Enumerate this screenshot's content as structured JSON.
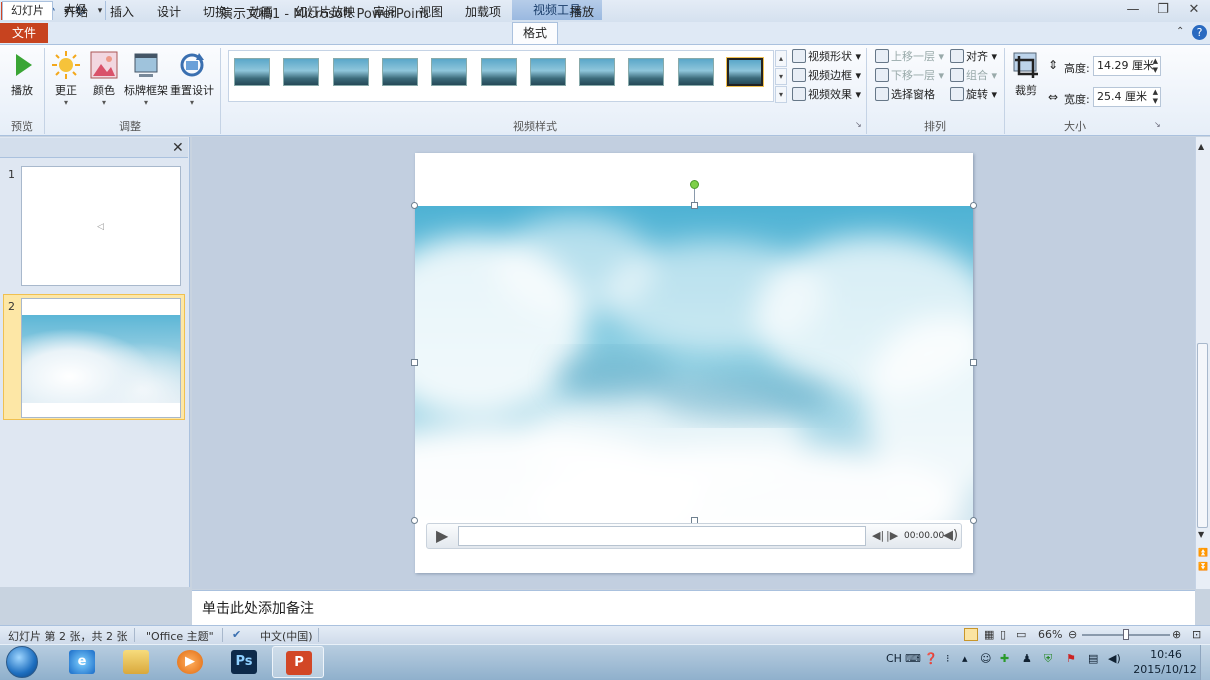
{
  "window": {
    "title": "演示文稿1 - Microsoft PowerPoint",
    "app_icon": "P",
    "context_tools_header": "视频工具"
  },
  "tabs": {
    "file": "文件",
    "items": [
      "开始",
      "插入",
      "设计",
      "切换",
      "动画",
      "幻灯片放映",
      "审阅",
      "视图",
      "加载项",
      "格式",
      "播放"
    ],
    "active": "格式"
  },
  "ribbon": {
    "preview": {
      "play_label": "播放",
      "group_label": "预览"
    },
    "adjust": {
      "correct_label": "更正",
      "color_label": "颜色",
      "poster_frame_label": "标牌框架",
      "reset_design_label": "重置设计",
      "group_label": "调整"
    },
    "video_styles": {
      "group_label": "视频样式",
      "shape_label": "视频形状",
      "border_label": "视频边框",
      "effects_label": "视频效果",
      "thumb_count": 11,
      "selected_index": 10
    },
    "arrange": {
      "group_label": "排列",
      "bring_forward": "上移一层",
      "send_backward": "下移一层",
      "selection_pane": "选择窗格",
      "align": "对齐",
      "group": "组合",
      "rotate": "旋转"
    },
    "size": {
      "group_label": "大小",
      "crop_label": "裁剪",
      "height_label": "高度:",
      "height_value": "14.29 厘米",
      "width_label": "宽度:",
      "width_value": "25.4 厘米"
    }
  },
  "left_pane": {
    "tab_slides": "幻灯片",
    "tab_outline": "大纲",
    "slides": [
      {
        "number": "1"
      },
      {
        "number": "2"
      }
    ],
    "selected_slide": "2"
  },
  "video_player": {
    "time": "00:00.00"
  },
  "notes": {
    "placeholder": "单击此处添加备注"
  },
  "status": {
    "slide_info": "幻灯片 第 2 张，共 2 张",
    "theme": "\"Office 主题\"",
    "language": "中文(中国)",
    "zoom": "66%",
    "zoom_fraction": 0.5
  },
  "taskbar": {
    "apps": [
      "internet-explorer",
      "file-explorer",
      "media-player",
      "photoshop",
      "powerpoint"
    ],
    "photoshop_label": "Ps",
    "powerpoint_label": "P",
    "input_lang": "CH",
    "clock_time": "10:46",
    "clock_date": "2015/10/12"
  },
  "colors": {
    "file_tab": "#c7431f",
    "ribbon_border": "#aac1de",
    "selected_slide_highlight": "#fde7a6",
    "rotation_handle": "#7ed04a"
  }
}
